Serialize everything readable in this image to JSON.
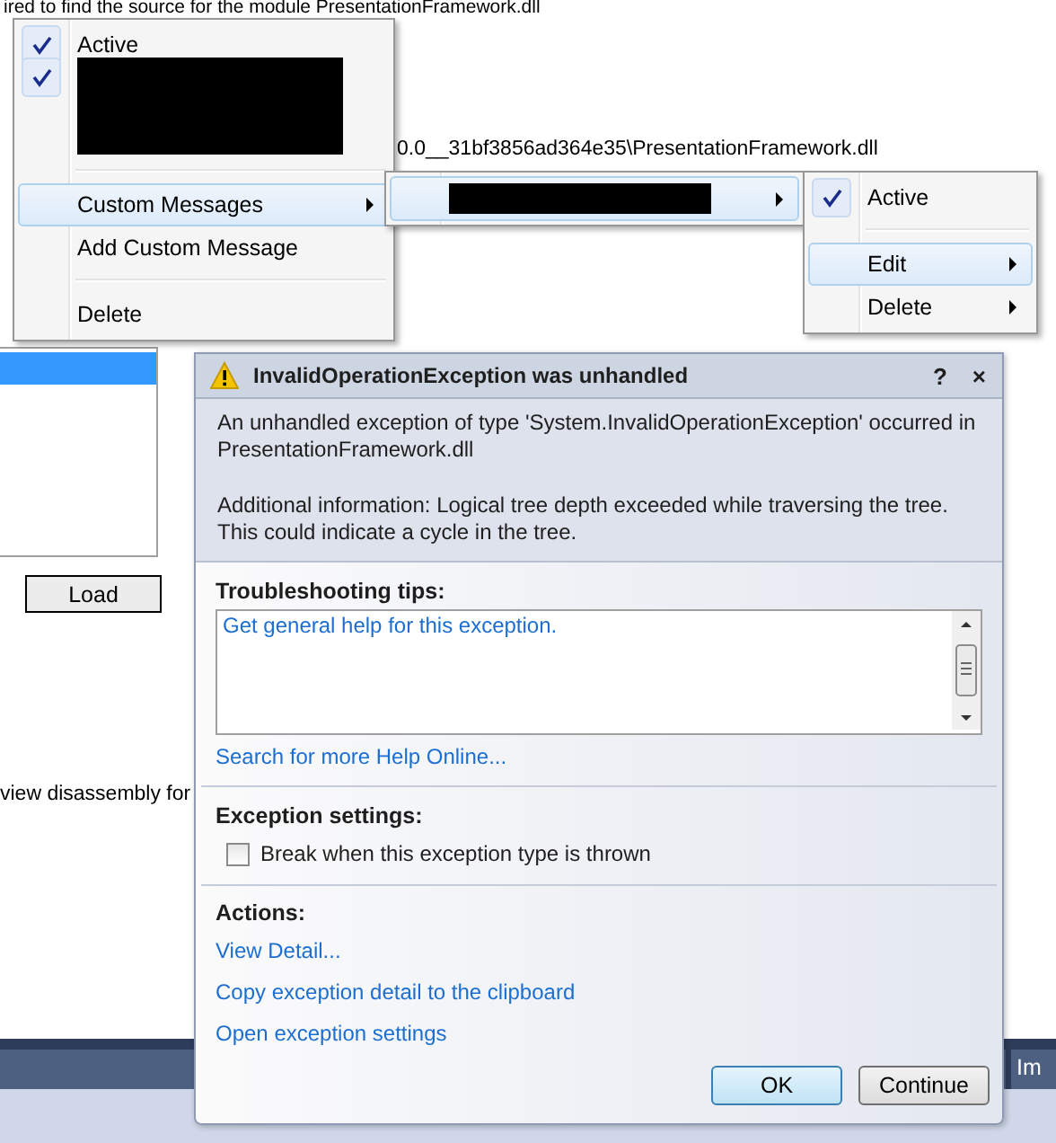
{
  "background": {
    "header_text": "ired to find the source for the module PresentationFramework.dll",
    "path_text": "0.0__31bf3856ad364e35\\PresentationFramework.dll",
    "list_rows": [
      {
        "selected": true
      }
    ],
    "load_button": "Load",
    "side_text": "view disassembly for",
    "panel_tab": "Im"
  },
  "menus": [
    {
      "items": [
        {
          "kind": "item",
          "label": "Active",
          "checked": true,
          "selected": false
        },
        {
          "kind": "redacted",
          "checked": true,
          "selected": false
        },
        {
          "kind": "separator"
        },
        {
          "kind": "submenu",
          "label": "Custom Messages",
          "selected": true
        },
        {
          "kind": "item",
          "label": "Add Custom Message",
          "selected": false
        },
        {
          "kind": "separator"
        },
        {
          "kind": "item",
          "label": "Delete",
          "selected": false
        }
      ]
    },
    {
      "items": [
        {
          "kind": "redacted-submenu",
          "selected": true
        }
      ]
    },
    {
      "items": [
        {
          "kind": "item",
          "label": "Active",
          "checked": true,
          "selected": false
        },
        {
          "kind": "separator"
        },
        {
          "kind": "submenu",
          "label": "Edit",
          "selected": true
        },
        {
          "kind": "submenu",
          "label": "Delete",
          "selected": false
        }
      ]
    }
  ],
  "dialog": {
    "title": "InvalidOperationException was unhandled",
    "help": "?",
    "close": "×",
    "message": "An unhandled exception of type 'System.InvalidOperationException' occurred in PresentationFramework.dll",
    "additional": "Additional information: Logical tree depth exceeded while traversing the tree. This could indicate a cycle in the tree.",
    "tips_heading": "Troubleshooting tips:",
    "tips": [
      "Get general help for this exception."
    ],
    "search_link": "Search for more Help Online...",
    "settings_heading": "Exception settings:",
    "break_option": {
      "label": "Break when this exception type is thrown",
      "checked": false
    },
    "actions_heading": "Actions:",
    "actions": [
      "View Detail...",
      "Copy exception detail to the clipboard",
      "Open exception settings"
    ],
    "buttons": [
      {
        "label": "OK",
        "default": true
      },
      {
        "label": "Continue",
        "default": false
      }
    ]
  }
}
